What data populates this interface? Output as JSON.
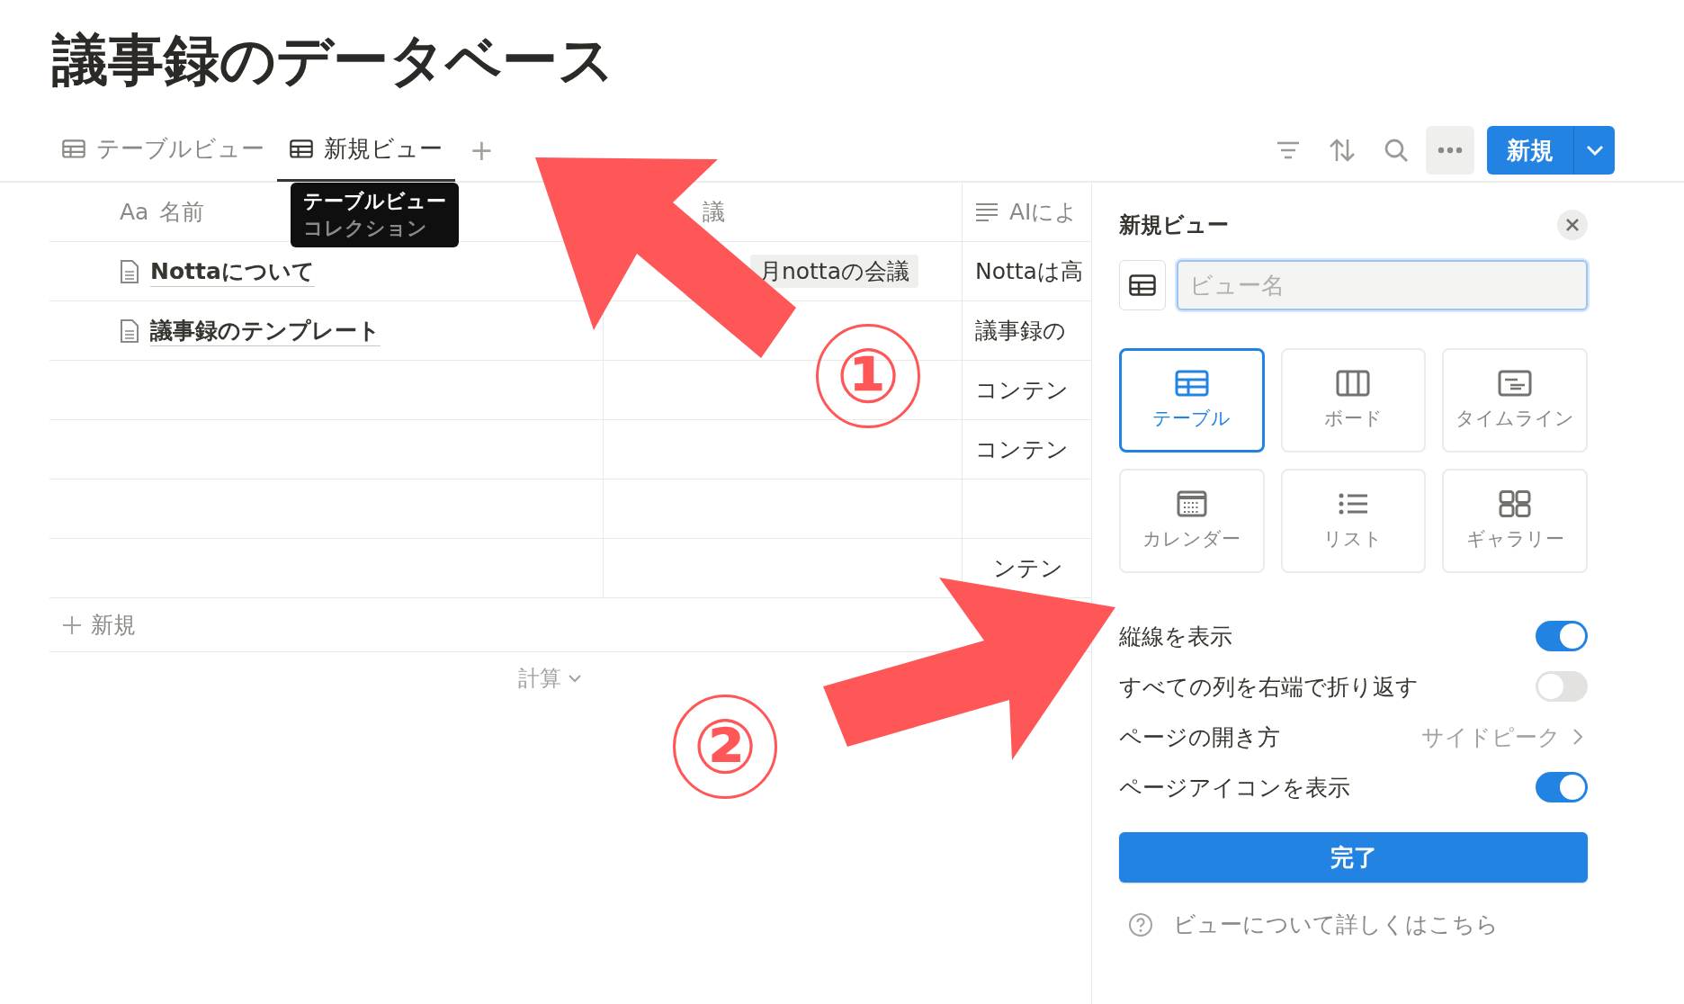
{
  "title": "議事録のデータベース",
  "tabs": [
    {
      "label": "テーブルビュー",
      "selected": false
    },
    {
      "label": "新規ビュー",
      "selected": true
    }
  ],
  "add_tab": "+",
  "tooltip": {
    "title": "テーブルビュー",
    "subtitle": "コレクション"
  },
  "toolbar": {
    "new_button": "新規"
  },
  "table": {
    "name_type": "Aa",
    "columns": [
      {
        "label": "名前",
        "kind": "title"
      },
      {
        "label": "議",
        "kind": "relation"
      },
      {
        "label": "AIによ",
        "kind": "text"
      }
    ],
    "rows": [
      {
        "name": "Nottaについて",
        "relation": "月nottaの会議",
        "summary": "Nottaは高"
      },
      {
        "name": "議事録のテンプレート",
        "summary": "議事録の"
      },
      {
        "summary": "コンテン"
      },
      {
        "summary": "コンテン"
      },
      {},
      {
        "summary": "ンテン"
      }
    ],
    "new_row": "新規",
    "calculate": "計算"
  },
  "panel": {
    "title": "新規ビュー",
    "name_placeholder": "ビュー名",
    "layouts": [
      {
        "label": "テーブル",
        "kind": "table",
        "selected": true
      },
      {
        "label": "ボード",
        "kind": "board",
        "selected": false
      },
      {
        "label": "タイムライン",
        "kind": "timeline",
        "selected": false
      },
      {
        "label": "カレンダー",
        "kind": "calendar",
        "selected": false
      },
      {
        "label": "リスト",
        "kind": "list",
        "selected": false
      },
      {
        "label": "ギャラリー",
        "kind": "gallery",
        "selected": false
      }
    ],
    "settings": [
      {
        "label": "縦線を表示",
        "kind": "toggle",
        "on": true
      },
      {
        "label": "すべての列を右端で折り返す",
        "kind": "toggle",
        "on": false
      },
      {
        "label": "ページの開き方",
        "kind": "link",
        "value": "サイドピーク"
      },
      {
        "label": "ページアイコンを表示",
        "kind": "toggle",
        "on": true
      }
    ],
    "done": "完了",
    "help": "ビューについて詳しくはこちら"
  },
  "annotations": [
    {
      "label": "①"
    },
    {
      "label": "②"
    }
  ]
}
